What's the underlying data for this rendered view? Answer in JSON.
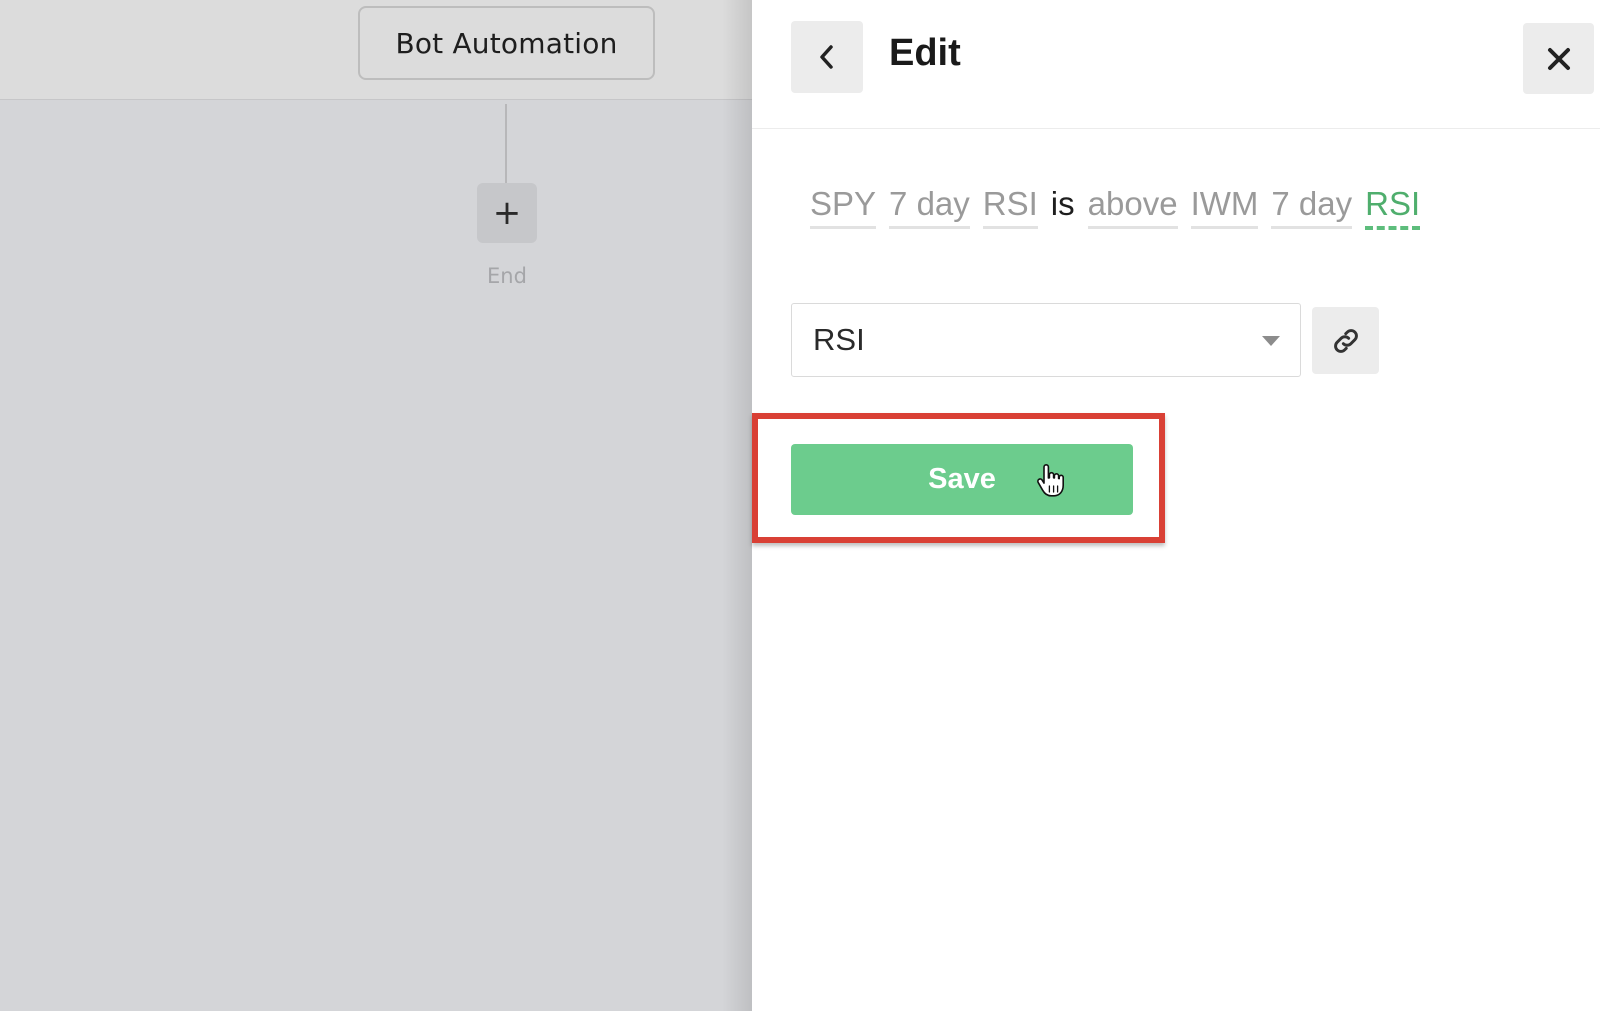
{
  "canvas": {
    "bot_node_label": "Bot Automation",
    "add_node_symbol": "+",
    "end_label": "End"
  },
  "panel": {
    "title": "Edit",
    "back_icon": "chevron-left-icon",
    "close_icon": "close-icon",
    "sentence": {
      "tokens": [
        "SPY",
        "7 day",
        "RSI",
        "is",
        "above",
        "IWM",
        "7 day",
        "RSI"
      ],
      "active_token_index": 7
    },
    "select": {
      "value": "RSI",
      "caret_icon": "caret-down-icon"
    },
    "link_icon": "link-icon",
    "save_label": "Save"
  },
  "colors": {
    "accent_green": "#6ccc8d",
    "active_token": "#4fae6d",
    "highlight_red": "#d94035"
  }
}
